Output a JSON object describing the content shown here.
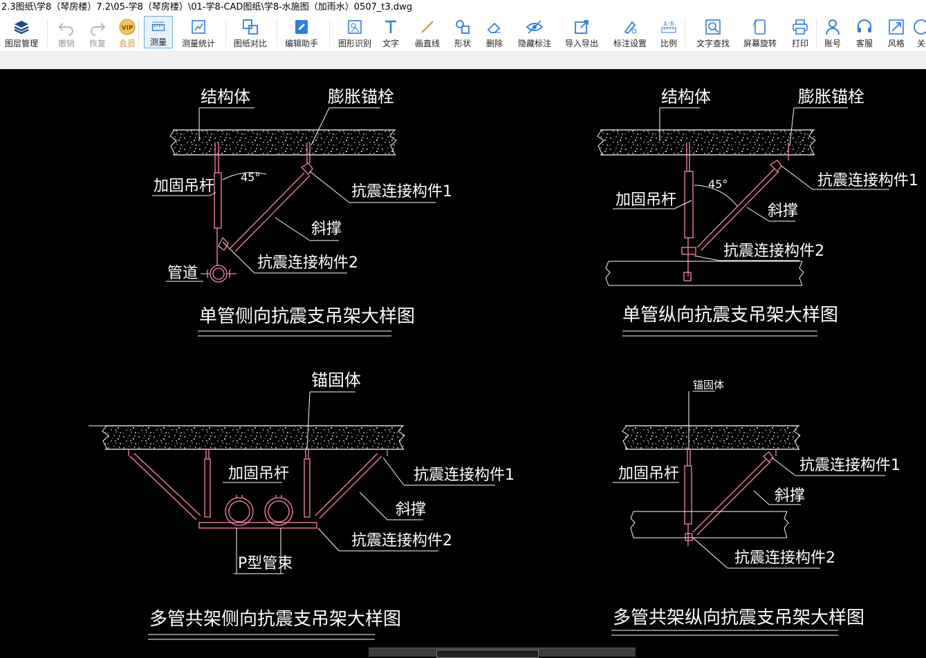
{
  "window": {
    "title": "2.3图纸\\学8（琴房楼）7.2\\05-学8（琴房楼）\\01-学8-CAD图纸\\学8-水施图（加雨水）0507_t3.dwg"
  },
  "toolbar": {
    "items": [
      {
        "label": "图层管理",
        "icon": "layers-icon",
        "state": "normal"
      },
      {
        "label": "撤销",
        "icon": "undo-icon",
        "state": "disabled"
      },
      {
        "label": "恢复",
        "icon": "redo-icon",
        "state": "disabled"
      },
      {
        "label": "会员",
        "icon": "vip-icon",
        "state": "vip"
      },
      {
        "label": "测量",
        "icon": "measure-icon",
        "state": "active"
      },
      {
        "label": "测量统计",
        "icon": "measure-stats-icon",
        "state": "normal"
      },
      {
        "label": "图纸对比",
        "icon": "compare-icon",
        "state": "normal"
      },
      {
        "label": "编辑助手",
        "icon": "edit-assistant-icon",
        "state": "normal"
      },
      {
        "label": "图形识别",
        "icon": "shape-recognition-icon",
        "state": "normal"
      },
      {
        "label": "文字",
        "icon": "text-icon",
        "state": "normal"
      },
      {
        "label": "画直线",
        "icon": "line-icon",
        "state": "normal"
      },
      {
        "label": "形状",
        "icon": "shape-icon",
        "state": "normal"
      },
      {
        "label": "删除",
        "icon": "eraser-icon",
        "state": "normal"
      },
      {
        "label": "隐藏标注",
        "icon": "hide-eye-icon",
        "state": "normal"
      },
      {
        "label": "导入导出",
        "icon": "import-export-icon",
        "state": "normal"
      },
      {
        "label": "标注设置",
        "icon": "annotation-settings-icon",
        "state": "normal"
      },
      {
        "label": "比例",
        "icon": "scale-icon",
        "state": "normal"
      },
      {
        "label": "文字查找",
        "icon": "text-search-icon",
        "state": "normal"
      },
      {
        "label": "屏幕旋转",
        "icon": "rotate-screen-icon",
        "state": "normal"
      },
      {
        "label": "打印",
        "icon": "printer-icon",
        "state": "normal"
      },
      {
        "label": "账号",
        "icon": "account-icon",
        "state": "normal"
      },
      {
        "label": "客服",
        "icon": "headset-icon",
        "state": "normal"
      },
      {
        "label": "风格",
        "icon": "style-icon",
        "state": "normal"
      },
      {
        "label": "关",
        "icon": "about-icon",
        "state": "normal"
      }
    ]
  },
  "drawing": {
    "colors": {
      "structure": "#ffffff",
      "member": "#ff88aa",
      "text": "#ffffff",
      "background": "#000000"
    },
    "d1": {
      "title": "单管侧向抗震支吊架大样图",
      "labels": {
        "structure": "结构体",
        "anchor": "膨胀锚栓",
        "rod": "加固吊杆",
        "angle": "45°",
        "conn1": "抗震连接构件1",
        "brace": "斜撑",
        "conn2": "抗震连接构件2",
        "pipe": "管道"
      }
    },
    "d2": {
      "title": "单管纵向抗震支吊架大样图",
      "labels": {
        "structure": "结构体",
        "anchor": "膨胀锚栓",
        "conn1": "抗震连接构件1",
        "angle": "45°",
        "rod": "加固吊杆",
        "brace": "斜撑",
        "conn2": "抗震连接构件2"
      }
    },
    "d3": {
      "title": "多管共架侧向抗震支吊架大样图",
      "labels": {
        "anchor": "锚固体",
        "rod": "加固吊杆",
        "conn1": "抗震连接构件1",
        "brace": "斜撑",
        "conn2": "抗震连接构件2",
        "clamp": "P型管束"
      }
    },
    "d4": {
      "title": "多管共架纵向抗震支吊架大样图",
      "labels": {
        "anchor": "锚固体",
        "conn1": "抗震连接构件1",
        "rod": "加固吊杆",
        "brace": "斜撑",
        "conn2": "抗震连接构件2"
      }
    }
  }
}
